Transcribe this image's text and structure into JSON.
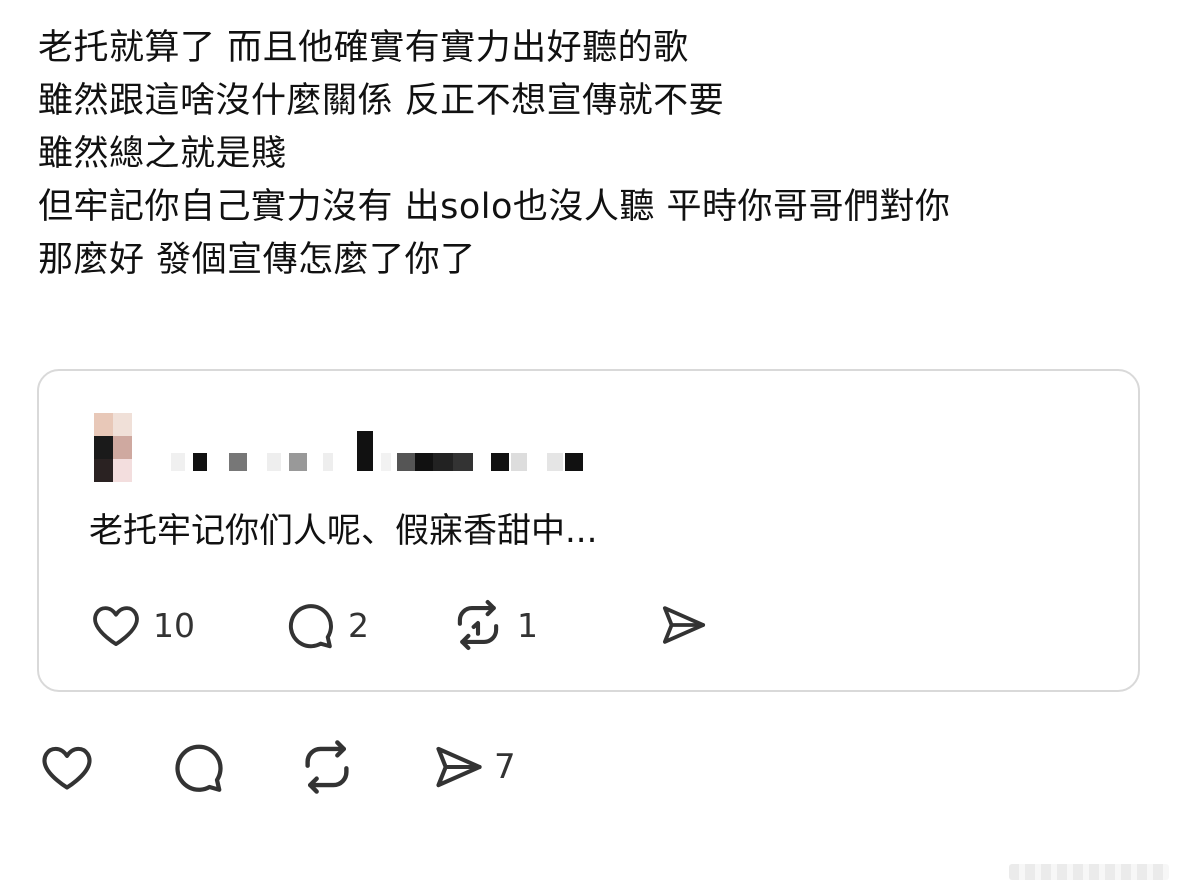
{
  "post": {
    "lines": [
      "老托就算了 而且他確實有實力出好聽的歌",
      "雖然跟這啥沒什麼關係 反正不想宣傳就不要",
      "雖然總之就是賤",
      "但牢記你自己實力沒有 出solo也沒人聽 平時你哥哥們對你",
      "那麼好 發個宣傳怎麼了你了"
    ]
  },
  "quoted_post": {
    "username_redacted": true,
    "text": "老托牢记你们人呢、假寐香甜中...",
    "likes": "10",
    "replies": "2",
    "reposts": "1"
  },
  "actions": {
    "shares": "7"
  },
  "icons": {
    "like": "heart-icon",
    "reply": "comment-bubble-icon",
    "repost": "repost-icon",
    "share": "send-icon"
  },
  "colors": {
    "text": "#111111",
    "icon": "#333333",
    "card_border": "#d9d9d9"
  }
}
